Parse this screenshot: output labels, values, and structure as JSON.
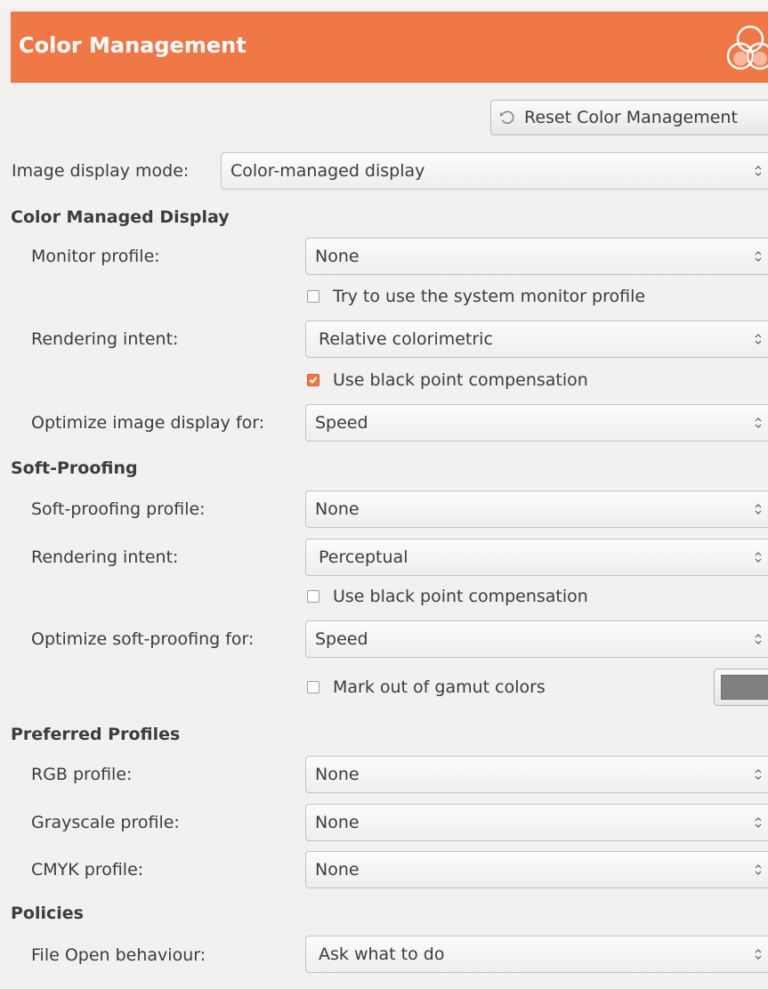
{
  "header": {
    "title": "Color Management"
  },
  "reset_button": {
    "label": "Reset Color Management"
  },
  "image_display_mode": {
    "label": "Image display mode:",
    "value": "Color-managed display"
  },
  "color_managed_display": {
    "title": "Color Managed Display",
    "monitor_profile": {
      "label": "Monitor profile:",
      "value": "None"
    },
    "system_monitor_checkbox": {
      "label": "Try to use the system monitor profile",
      "checked": false
    },
    "rendering_intent": {
      "label": "Rendering intent:",
      "value": "Relative colorimetric"
    },
    "black_point_checkbox": {
      "label": "Use black point compensation",
      "checked": true
    },
    "optimize": {
      "label": "Optimize image display for:",
      "value": "Speed"
    }
  },
  "soft_proofing": {
    "title": "Soft-Proofing",
    "profile": {
      "label": "Soft-proofing profile:",
      "value": "None"
    },
    "rendering_intent": {
      "label": "Rendering intent:",
      "value": "Perceptual"
    },
    "black_point_checkbox": {
      "label": "Use black point compensation",
      "checked": false
    },
    "optimize": {
      "label": "Optimize soft-proofing for:",
      "value": "Speed"
    },
    "gamut_checkbox": {
      "label": "Mark out of gamut colors",
      "checked": false
    },
    "gamut_color": "#808080"
  },
  "preferred_profiles": {
    "title": "Preferred Profiles",
    "rgb": {
      "label": "RGB profile:",
      "value": "None"
    },
    "grayscale": {
      "label": "Grayscale profile:",
      "value": "None"
    },
    "cmyk": {
      "label": "CMYK profile:",
      "value": "None"
    }
  },
  "policies": {
    "title": "Policies",
    "file_open": {
      "label": "File Open behaviour:",
      "value": "Ask what to do"
    }
  },
  "colors": {
    "accent": "#f07746",
    "background": "#f2f1f0",
    "text": "#3c3c3c"
  }
}
